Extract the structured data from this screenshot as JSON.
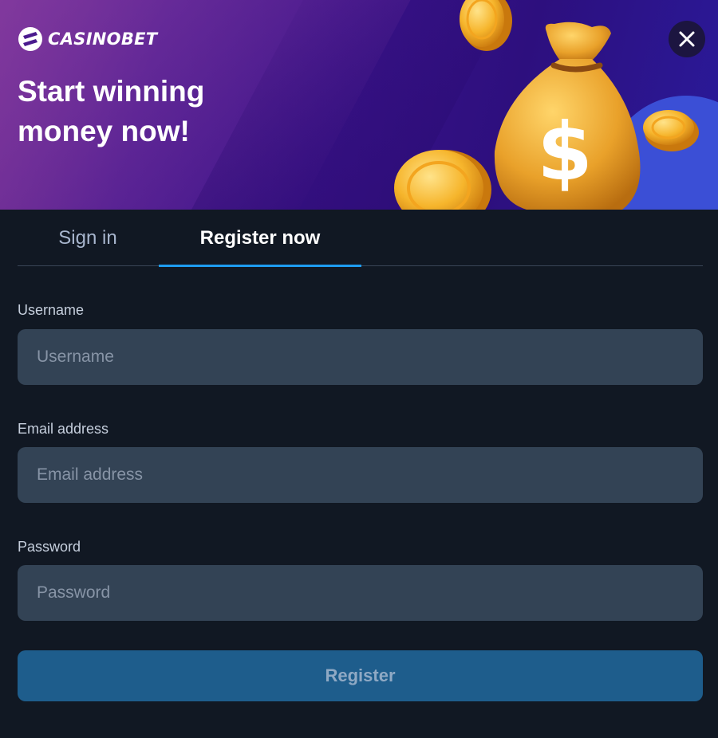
{
  "brand": {
    "name": "CASINOBET",
    "logo_icon": "casinobet-logo-icon"
  },
  "banner": {
    "headline": "Start winning money now!",
    "close_icon": "close-icon",
    "illustration": "money-bag-with-coins"
  },
  "tabs": [
    {
      "label": "Sign in",
      "active": false
    },
    {
      "label": "Register now",
      "active": true
    }
  ],
  "form": {
    "username": {
      "label": "Username",
      "placeholder": "Username",
      "value": ""
    },
    "email": {
      "label": "Email address",
      "placeholder": "Email address",
      "value": ""
    },
    "password": {
      "label": "Password",
      "placeholder": "Password",
      "value": ""
    },
    "submit_label": "Register"
  },
  "colors": {
    "background": "#111823",
    "input_bg": "#334355",
    "accent": "#1e9cf0",
    "button_bg": "#1e5d8c",
    "button_text": "#8fa9c4"
  }
}
